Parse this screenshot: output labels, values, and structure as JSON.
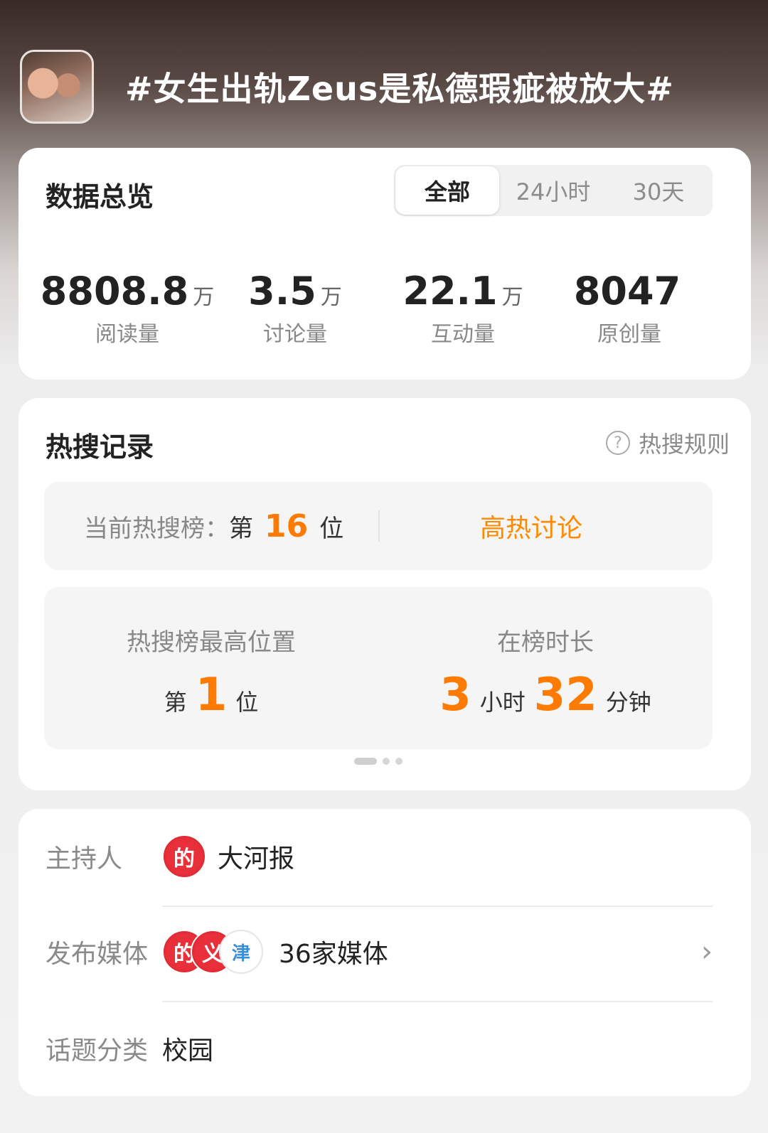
{
  "header": {
    "topic_title": "#女生出轨Zeus是私德瑕疵被放大#"
  },
  "overview": {
    "title": "数据总览",
    "tabs": [
      {
        "label": "全部",
        "active": true
      },
      {
        "label": "24小时",
        "active": false
      },
      {
        "label": "30天",
        "active": false
      }
    ],
    "stats": [
      {
        "value": "8808.8",
        "unit": "万",
        "label": "阅读量"
      },
      {
        "value": "3.5",
        "unit": "万",
        "label": "讨论量"
      },
      {
        "value": "22.1",
        "unit": "万",
        "label": "互动量"
      },
      {
        "value": "8047",
        "unit": "",
        "label": "原创量"
      }
    ]
  },
  "hot_search": {
    "title": "热搜记录",
    "rules_label": "热搜规则",
    "rules_icon": "question-circle-icon",
    "current_label": "当前热搜榜：",
    "current_prefix": "第",
    "current_rank": "16",
    "current_suffix": "位",
    "hot_tag": "高热讨论",
    "peak_label": "热搜榜最高位置",
    "peak_prefix": "第",
    "peak_rank": "1",
    "peak_suffix": "位",
    "duration_label": "在榜时长",
    "duration_hours": "3",
    "duration_hours_unit": "小时",
    "duration_minutes": "32",
    "duration_minutes_unit": "分钟",
    "accent_color": "#ff7a00"
  },
  "info": {
    "host_label": "主持人",
    "host_name": "大河报",
    "host_logo_text": "的",
    "media_label": "发布媒体",
    "media_logos": [
      "的",
      "义",
      "津"
    ],
    "media_count": "36家媒体",
    "category_label": "话题分类",
    "category_value": "校园"
  }
}
